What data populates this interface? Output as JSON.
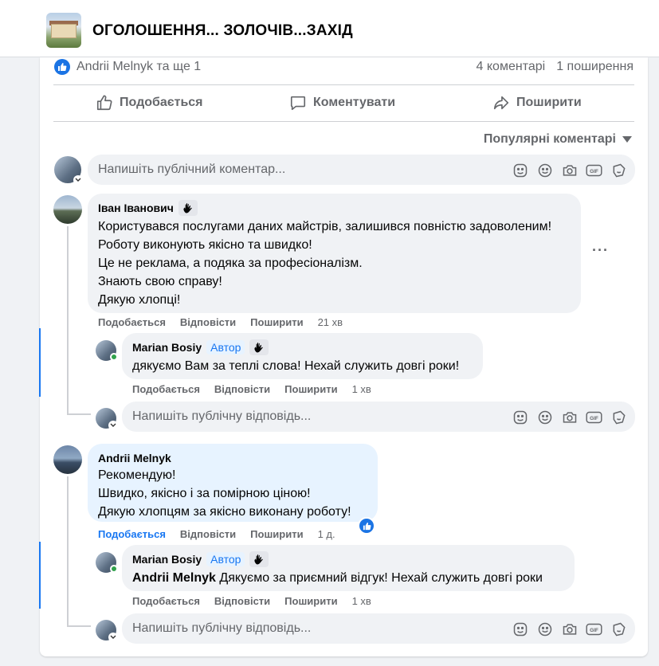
{
  "group": {
    "title": "ОГОЛОШЕННЯ... ЗОЛОЧІВ...ЗАХІД"
  },
  "stats": {
    "reactors": "Andrii Melnyk та ще 1",
    "comments": "4 коментарі",
    "shares": "1 поширення"
  },
  "actions": {
    "like": "Подобається",
    "comment": "Коментувати",
    "share": "Поширити"
  },
  "sort": {
    "label": "Популярні коментарі"
  },
  "composer": {
    "placeholder": "Напишіть публічний коментар..."
  },
  "comments": [
    {
      "author": "Іван Іванович",
      "lines": [
        "Користувався послугами даних майстрів, залишився повністю задоволеним!",
        "Роботу виконують якісно та швидко!",
        "Це не реклама, а подяка за професіоналізм.",
        "Знають свою справу!",
        "Дякую хлопці!"
      ],
      "actions": {
        "like": "Подобається",
        "reply": "Відповісти",
        "share": "Поширити",
        "time": "21 хв"
      },
      "more": "···",
      "reply": {
        "author": "Marian Bosiy",
        "badge": "Автор",
        "text": "дякуємо Вам за теплі слова! Нехай служить довгі роки!",
        "actions": {
          "like": "Подобається",
          "reply": "Відповісти",
          "share": "Поширити",
          "time": "1 хв"
        }
      },
      "reply_placeholder": "Напишіть публічну відповідь..."
    },
    {
      "author": "Andrii Melnyk",
      "lines": [
        "Рекомендую!",
        "Швидко, якісно і за помірною ціною!",
        "Дякую хлопцям за якісно виконану роботу!"
      ],
      "actions": {
        "like": "Подобається",
        "reply": "Відповісти",
        "share": "Поширити",
        "time": "1 д."
      },
      "reply": {
        "author": "Marian Bosiy",
        "badge": "Автор",
        "mention": "Andrii Melnyk",
        "text": " Дякуємо за приємний відгук! Нехай служить довгі роки",
        "actions": {
          "like": "Подобається",
          "reply": "Відповісти",
          "share": "Поширити",
          "time": "1 хв"
        }
      },
      "reply_placeholder": "Напишіть публічну відповідь..."
    }
  ],
  "icons": {
    "like": "thumbs-up-icon",
    "comment": "speech-bubble-icon",
    "share": "share-arrow-icon",
    "sort": "caret-down-icon",
    "sticker": "sticker-icon",
    "emoji": "smiley-icon",
    "camera": "camera-icon",
    "gif": "gif-icon",
    "avatar_sticker": "avatar-sticker-icon",
    "wave": "waving-hand-icon"
  },
  "colors": {
    "accent": "#1877f2",
    "muted": "#65676b",
    "bubble": "#f0f2f5",
    "highlight": "#e7f3ff",
    "online": "#31a24c"
  }
}
